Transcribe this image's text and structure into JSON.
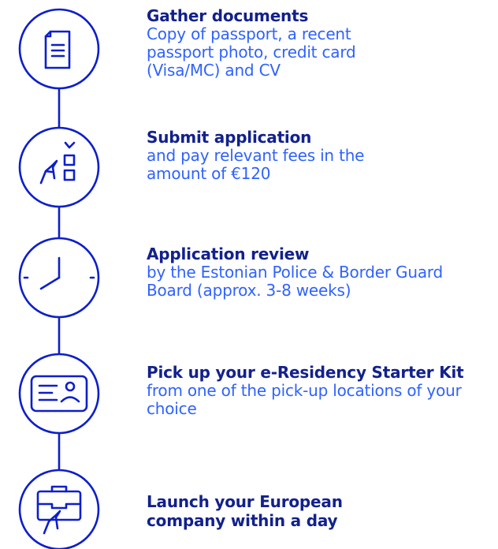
{
  "colors": {
    "line": "#0d1fc9",
    "title": "#12218c",
    "description": "#2f62ff",
    "background": "#ffffff"
  },
  "steps": [
    {
      "icon": "document-icon",
      "title": "Gather documents",
      "description": "Copy of passport, a recent passport photo, credit card (Visa/MC) and CV"
    },
    {
      "icon": "application-checklist-icon",
      "title": "Submit application",
      "description": "and pay relevant fees in the amount of €120"
    },
    {
      "icon": "clock-icon",
      "title": "Application review",
      "description": "by the Estonian Police & Border Guard Board (approx. 3-8 weeks)"
    },
    {
      "icon": "id-card-icon",
      "title": "Pick up your e-Residency Starter Kit",
      "description": "from one of the pick-up locations of your choice"
    },
    {
      "icon": "briefcase-cursor-icon",
      "title": "Launch your European company within a day",
      "description": ""
    }
  ]
}
